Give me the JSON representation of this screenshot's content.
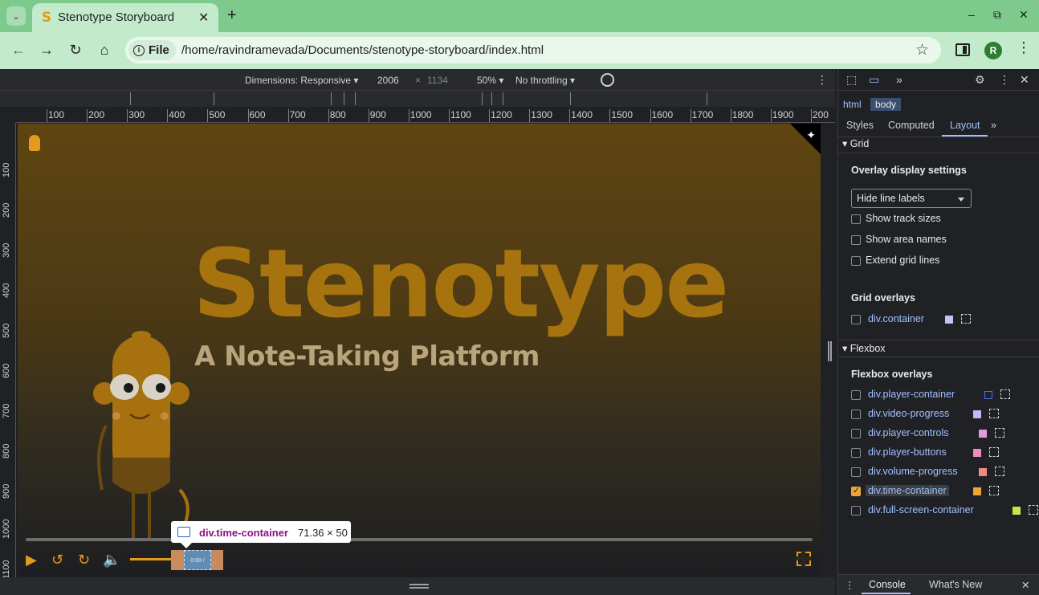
{
  "browser": {
    "tab_title": "Stenotype Storyboard",
    "tab_favicon": "S",
    "tab_close": "✕",
    "new_tab": "+",
    "tab_list": "⌄",
    "window_controls": [
      "–",
      "⧉",
      "✕"
    ],
    "url_scheme_label": "File",
    "url": "/home/ravindramevada/Documents/stenotype-storyboard/index.html",
    "avatar_letter": "R",
    "icons": [
      "back-icon",
      "forward-icon",
      "reload-icon",
      "home-icon",
      "info-icon",
      "star-icon",
      "side-panel-icon",
      "menu-icon"
    ]
  },
  "device_toolbar": {
    "dimensions_label": "Dimensions: Responsive",
    "width": "2006",
    "times": "×",
    "height": "1134",
    "zoom": "50%",
    "throttling": "No throttling"
  },
  "ruler": {
    "horizontal": [
      "100",
      "200",
      "300",
      "400",
      "500",
      "600",
      "700",
      "800",
      "900",
      "1000",
      "1100",
      "1200",
      "1300",
      "1400",
      "1500",
      "1600",
      "1700",
      "1800",
      "1900",
      "200"
    ],
    "vertical": [
      "100",
      "200",
      "300",
      "400",
      "500",
      "600",
      "700",
      "800",
      "900",
      "1000",
      "1100"
    ]
  },
  "page": {
    "title": "Stenotype",
    "subtitle": "A Note-Taking Platform",
    "time_text": "0:00 / 0:00"
  },
  "tooltip": {
    "element": "div.time-container",
    "size": "71.36 × 50"
  },
  "devtools": {
    "breadcrumbs": [
      "html",
      "body"
    ],
    "subtabs": [
      "Styles",
      "Computed",
      "Layout"
    ],
    "more": "»",
    "grid_section": "Grid",
    "overlay_settings_label": "Overlay display settings",
    "overlay_select_value": "Hide line labels",
    "grid_options": [
      "Show track sizes",
      "Show area names",
      "Extend grid lines"
    ],
    "grid_overlays_label": "Grid overlays",
    "grid_overlays": [
      {
        "name": "div.container",
        "color": "#c8c3f0",
        "checked": false
      }
    ],
    "flexbox_section": "Flexbox",
    "flexbox_overlays_label": "Flexbox overlays",
    "flexbox_overlays": [
      {
        "name": "div.player-container",
        "color": "#1f3b8c",
        "checked": false
      },
      {
        "name": "div.video-progress",
        "color": "#cbb7f0",
        "checked": false
      },
      {
        "name": "div.player-controls",
        "color": "#e39ae0",
        "checked": false
      },
      {
        "name": "div.player-buttons",
        "color": "#f08bc2",
        "checked": false
      },
      {
        "name": "div.volume-progress",
        "color": "#f08a8a",
        "checked": false
      },
      {
        "name": "div.time-container",
        "color": "#f0a435",
        "checked": true
      },
      {
        "name": "div.full-screen-container",
        "color": "#c5e84a",
        "checked": false
      }
    ],
    "drawer_tabs": [
      "Console",
      "What's New"
    ]
  }
}
